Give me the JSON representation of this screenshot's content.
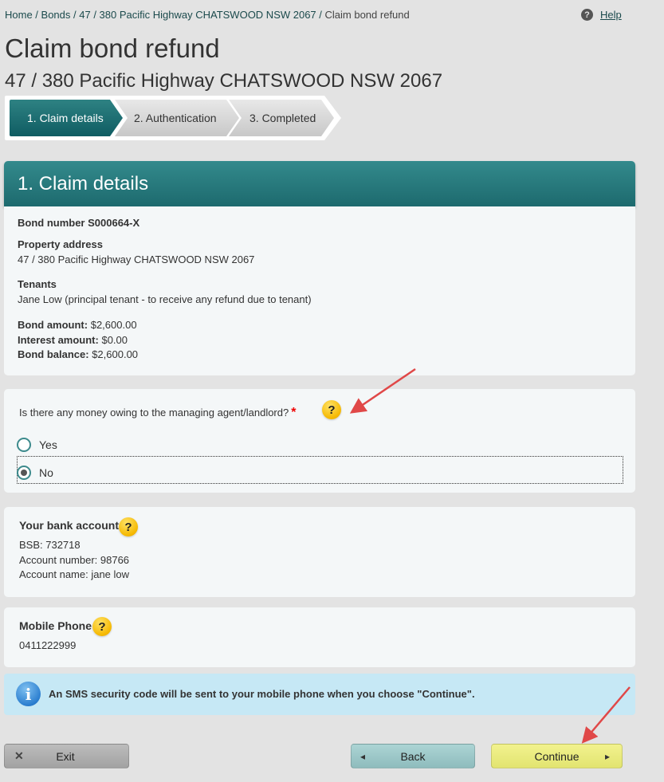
{
  "breadcrumb": {
    "items": [
      "Home",
      "Bonds",
      "47 / 380 Pacific Highway CHATSWOOD NSW 2067"
    ],
    "current": "Claim bond refund",
    "separator": " / "
  },
  "help": {
    "icon": "question-circle-icon",
    "label": "Help"
  },
  "page": {
    "title": "Claim bond refund",
    "subtitle": "47 / 380 Pacific Highway CHATSWOOD NSW 2067"
  },
  "steps": [
    {
      "label": "1. Claim details",
      "active": true
    },
    {
      "label": "2. Authentication",
      "active": false
    },
    {
      "label": "3. Completed",
      "active": false
    }
  ],
  "section": {
    "title": "1. Claim details"
  },
  "bond": {
    "number_label": "Bond number S000664-X",
    "property_label": "Property address",
    "property_value": "47 / 380 Pacific Highway CHATSWOOD NSW 2067",
    "tenants_label": "Tenants",
    "tenants_value": "Jane Low (principal tenant - to receive any refund due to tenant)",
    "amount_label": "Bond amount:",
    "amount_value": "$2,600.00",
    "interest_label": "Interest amount:",
    "interest_value": "$0.00",
    "balance_label": "Bond balance:",
    "balance_value": "$2,600.00"
  },
  "question": {
    "text": "Is there any money owing to the managing agent/landlord?",
    "required_mark": "*",
    "help_icon": "?",
    "options": [
      {
        "label": "Yes",
        "selected": false
      },
      {
        "label": "No",
        "selected": true
      }
    ]
  },
  "bank": {
    "title": "Your bank account",
    "help_icon": "?",
    "bsb": "BSB: 732718",
    "account_number": "Account number: 98766",
    "account_name": "Account name: jane low"
  },
  "mobile": {
    "title": "Mobile Phone",
    "help_icon": "?",
    "number": "0411222999"
  },
  "info": {
    "icon": "i",
    "text": "An SMS security code will be sent to your mobile phone when you choose \"Continue\"."
  },
  "buttons": {
    "exit": {
      "label": "Exit",
      "icon": "✕"
    },
    "back": {
      "label": "Back",
      "icon": "◂"
    },
    "continue": {
      "label": "Continue",
      "icon": "▸"
    }
  },
  "colors": {
    "accent": "#1d6a6e",
    "annotation_arrow": "#e04848",
    "help_badge": "#f5b800",
    "info_bg": "#c6e8f5"
  }
}
